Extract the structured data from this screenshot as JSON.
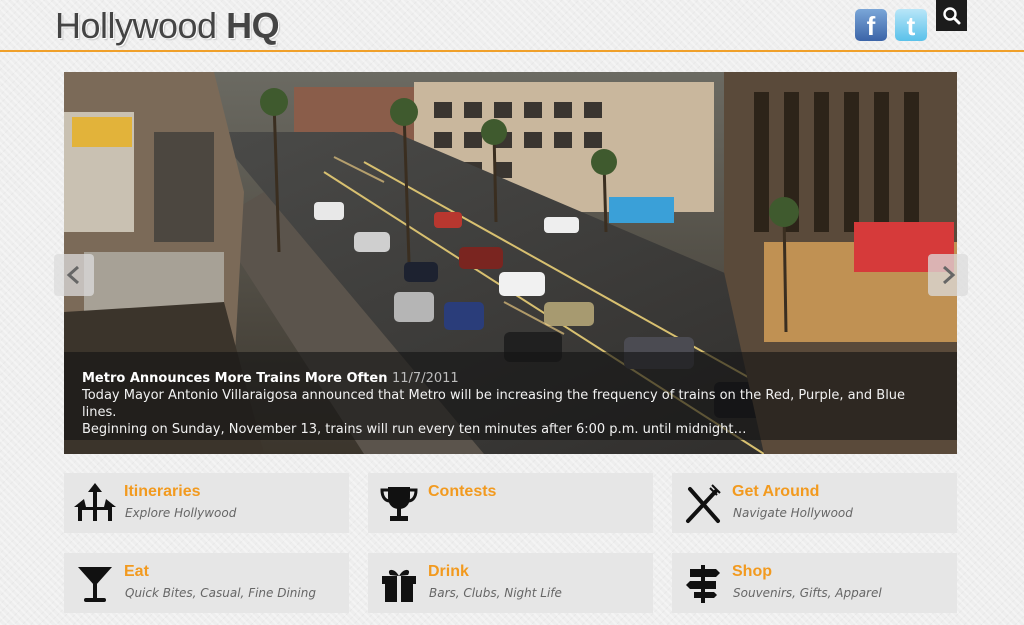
{
  "header": {
    "logo_regular": "Hollywood",
    "logo_bold": "HQ",
    "social": [
      {
        "name": "facebook",
        "glyph": "f",
        "icon": "facebook-icon"
      },
      {
        "name": "twitter",
        "glyph": "t",
        "icon": "twitter-icon"
      }
    ],
    "search_icon": "search-icon",
    "accent_color": "#f0a02a"
  },
  "slider": {
    "title": "Metro Announces More Trains More Often",
    "date": "11/7/2011",
    "body_line1": "Today Mayor Antonio Villaraigosa announced that Metro will be increasing the frequency of trains on the Red, Purple, and Blue lines.",
    "body_line2": "Beginning on Sunday, November 13, trains will run every ten minutes after 6:00 p.m. until midnight…",
    "prev_icon": "chevron-left-icon",
    "next_icon": "chevron-right-icon"
  },
  "tiles": [
    {
      "title": "Itineraries",
      "subtitle": "Explore Hollywood",
      "icon": "signpost-arrows-icon"
    },
    {
      "title": "Contests",
      "subtitle": "",
      "icon": "trophy-icon"
    },
    {
      "title": "Get Around",
      "subtitle": "Navigate Hollywood",
      "icon": "crossed-utensils-icon"
    },
    {
      "title": "Eat",
      "subtitle": "Quick Bites, Casual, Fine Dining",
      "icon": "martini-glass-icon"
    },
    {
      "title": "Drink",
      "subtitle": "Bars, Clubs, Night Life",
      "icon": "gift-box-icon"
    },
    {
      "title": "Shop",
      "subtitle": "Souvenirs, Gifts, Apparel",
      "icon": "directional-sign-icon"
    }
  ],
  "colors": {
    "tile_title": "#f29a1f",
    "tile_bg": "#e6e6e6"
  }
}
